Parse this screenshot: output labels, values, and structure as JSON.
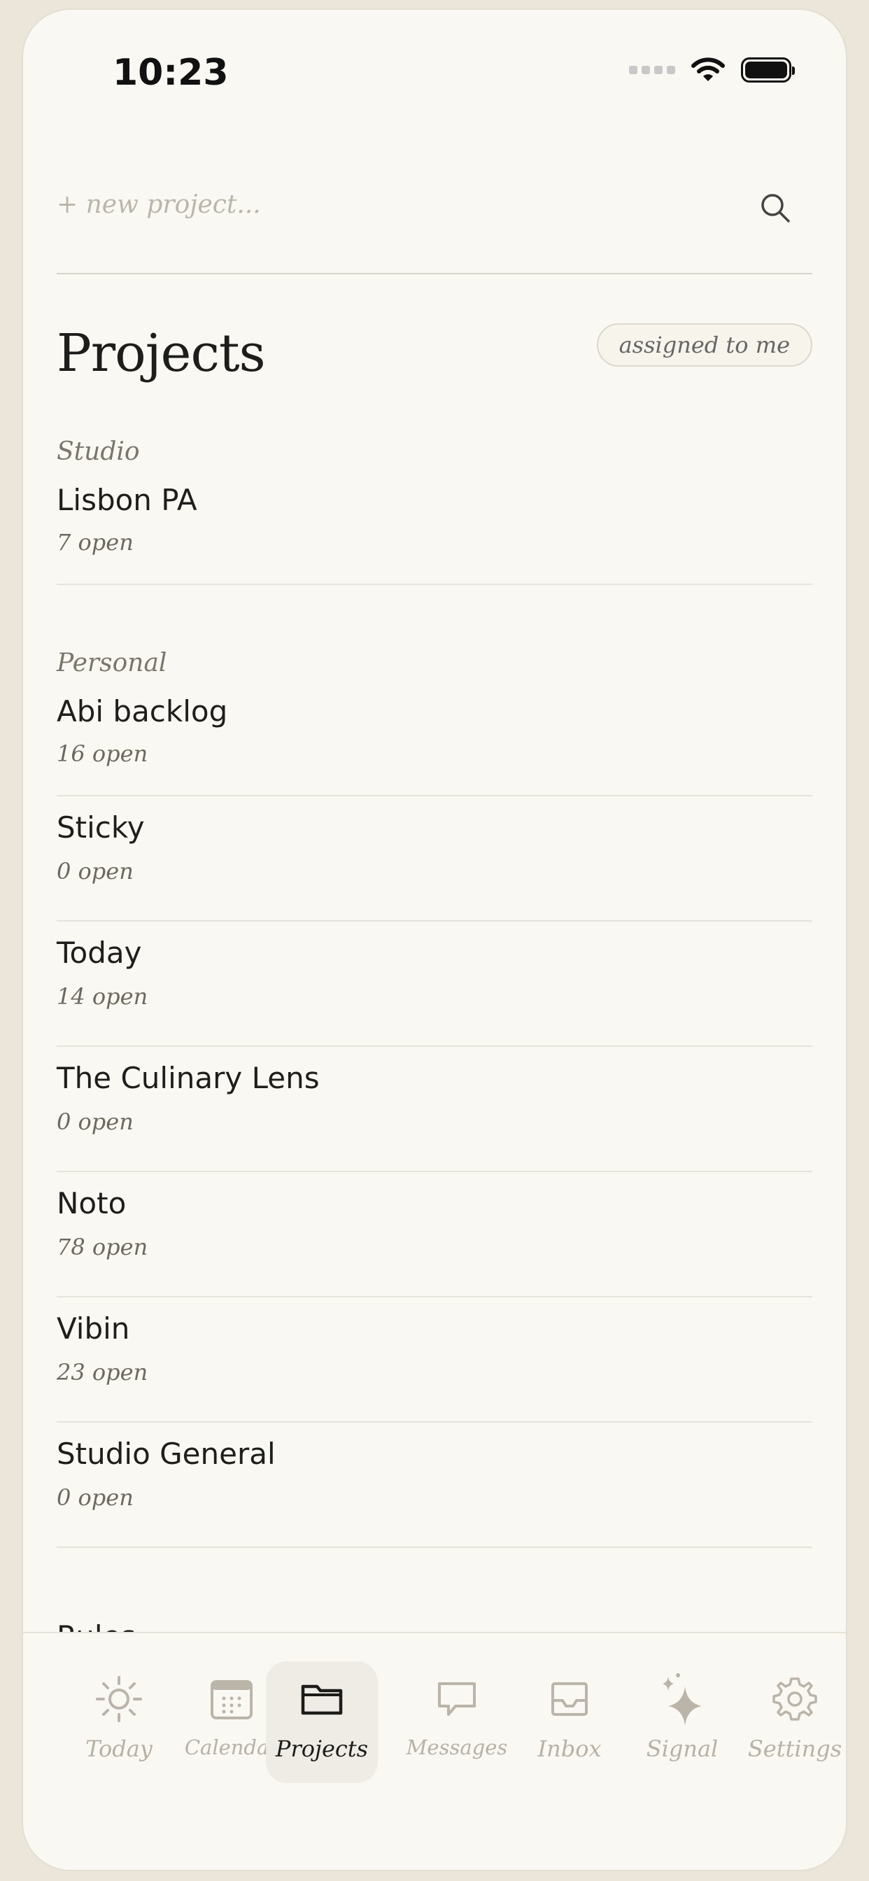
{
  "status": {
    "time": "10:23"
  },
  "new_project": {
    "placeholder": "+ new project..."
  },
  "header": {
    "title": "Projects",
    "filter": "assigned to me"
  },
  "groups": [
    {
      "label": "Studio",
      "items": [
        {
          "name": "Lisbon PA",
          "count": "7 open"
        }
      ]
    },
    {
      "label": "Personal",
      "items": [
        {
          "name": "Abi backlog",
          "count": "16 open"
        },
        {
          "name": "Sticky",
          "count": "0 open"
        },
        {
          "name": "Today",
          "count": "14 open"
        },
        {
          "name": "The Culinary Lens",
          "count": "0 open"
        },
        {
          "name": "Noto",
          "count": "78 open"
        },
        {
          "name": "Vibin",
          "count": "23 open"
        },
        {
          "name": "Studio General",
          "count": "0 open"
        }
      ]
    }
  ],
  "cut_item": "Rules",
  "tabs": [
    {
      "label": "Today",
      "icon": "sun-icon"
    },
    {
      "label": "Calendar",
      "icon": "calendar-icon"
    },
    {
      "label": "Projects",
      "icon": "folder-icon",
      "active": true
    },
    {
      "label": "Messages",
      "icon": "message-icon"
    },
    {
      "label": "Inbox",
      "icon": "inbox-icon"
    },
    {
      "label": "Signal",
      "icon": "sparkle-icon"
    },
    {
      "label": "Settings",
      "icon": "gear-icon"
    }
  ]
}
